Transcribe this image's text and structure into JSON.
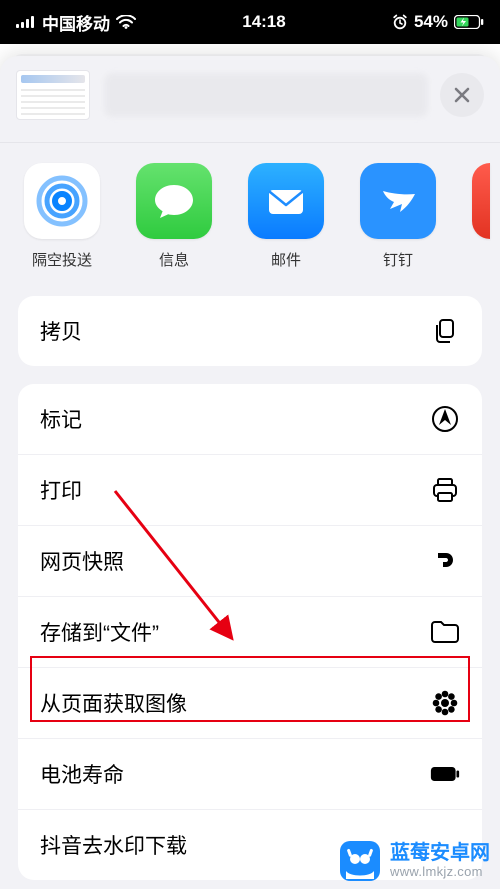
{
  "status": {
    "carrier": "中国移动",
    "time": "14:18",
    "battery_pct": "54%"
  },
  "share_apps": [
    {
      "id": "airdrop",
      "label": "隔空投送"
    },
    {
      "id": "messages",
      "label": "信息"
    },
    {
      "id": "mail",
      "label": "邮件"
    },
    {
      "id": "dingtalk",
      "label": "钉钉"
    }
  ],
  "actions_group1": {
    "copy": "拷贝"
  },
  "actions_group2": {
    "markup": "标记",
    "print": "打印",
    "webclip": "网页快照",
    "save_files": "存储到“文件”",
    "get_image": "从页面获取图像",
    "battery": "电池寿命",
    "douyin": "抖音去水印下载"
  },
  "watermark": {
    "title": "蓝莓安卓网",
    "url": "www.lmkjz.com"
  }
}
